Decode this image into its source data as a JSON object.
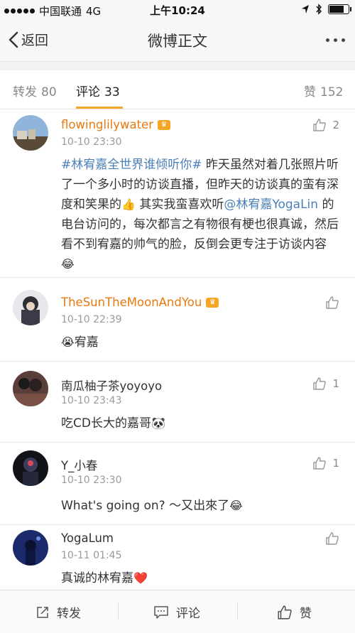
{
  "status_bar": {
    "carrier": "中国联通",
    "network": "4G",
    "time": "上午10:24",
    "battery_level": 0.85
  },
  "nav": {
    "back_label": "返回",
    "title": "微博正文"
  },
  "tabs": [
    {
      "label": "转发",
      "count": "80"
    },
    {
      "label": "评论",
      "count": "33"
    },
    {
      "label": "赞",
      "count": "152"
    }
  ],
  "comments": [
    {
      "username": "flowinglilywater",
      "time": "10-10 23:30",
      "likes": "2",
      "text": {
        "hashtag": "#林宥嘉全世界谁倾听你#",
        "part1": " 昨天虽然对着几张照片听了一个多小时的访谈直播，但昨天的访谈真的蛮有深度和笑果的",
        "emoji1": "👍",
        "part2": " 其实我蛮喜欢听",
        "mention": "@林宥嘉YogaLin",
        "part3": " 的电台访问的，每次都言之有物很有梗也很真诚，然后看不到宥嘉的帅气的脸，反倒会更专注于访谈内容",
        "emoji2": "😂"
      }
    },
    {
      "username": "TheSunTheMoonAndYou",
      "time": "10-10 22:39",
      "likes": "",
      "emoji": "😭",
      "text": "宥嘉"
    },
    {
      "username": "南瓜柚子茶yoyoyo",
      "time": "10-10 23:43",
      "likes": "1",
      "text": "吃CD长大的嘉哥",
      "emoji": "🐼"
    },
    {
      "username": "Y_小春",
      "time": "10-10 23:30",
      "likes": "1",
      "text": "What's going on? ～又出來了",
      "emoji": "😂"
    },
    {
      "username": "YogaLum",
      "time": "10-11 01:45",
      "likes": "",
      "text": "真诚的林宥嘉",
      "emoji": "❤️"
    }
  ],
  "bottom_bar": {
    "repost_label": "转发",
    "comment_label": "评论",
    "like_label": "赞"
  },
  "colors": {
    "accent": "#f5a623",
    "link": "#4a7fb7",
    "vip_name": "#e8790f"
  }
}
